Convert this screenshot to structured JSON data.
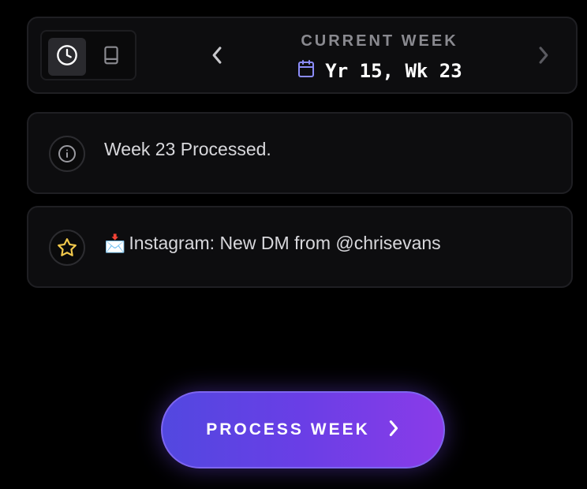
{
  "header": {
    "mode_toggle": [
      {
        "icon": "clock-icon",
        "active": true
      },
      {
        "icon": "book-icon",
        "active": false
      }
    ],
    "week_label": "CURRENT WEEK",
    "week_value": "Yr 15, Wk 23",
    "calendar_icon": "calendar-icon",
    "prev_icon": "chevron-left-icon",
    "next_icon": "chevron-right-icon"
  },
  "notifications": [
    {
      "icon": "info-icon",
      "text": "Week 23 Processed."
    },
    {
      "icon": "star-icon",
      "emoji": "📩",
      "text": "Instagram: New DM from @chrisevans"
    }
  ],
  "action": {
    "label": "PROCESS WEEK",
    "icon": "chevron-right-icon"
  },
  "colors": {
    "background": "#000000",
    "card": "#0d0d0f",
    "accent_start": "#5248e0",
    "accent_end": "#8a3ce8",
    "star": "#f2c94c",
    "calendar": "#8b8cf8"
  }
}
